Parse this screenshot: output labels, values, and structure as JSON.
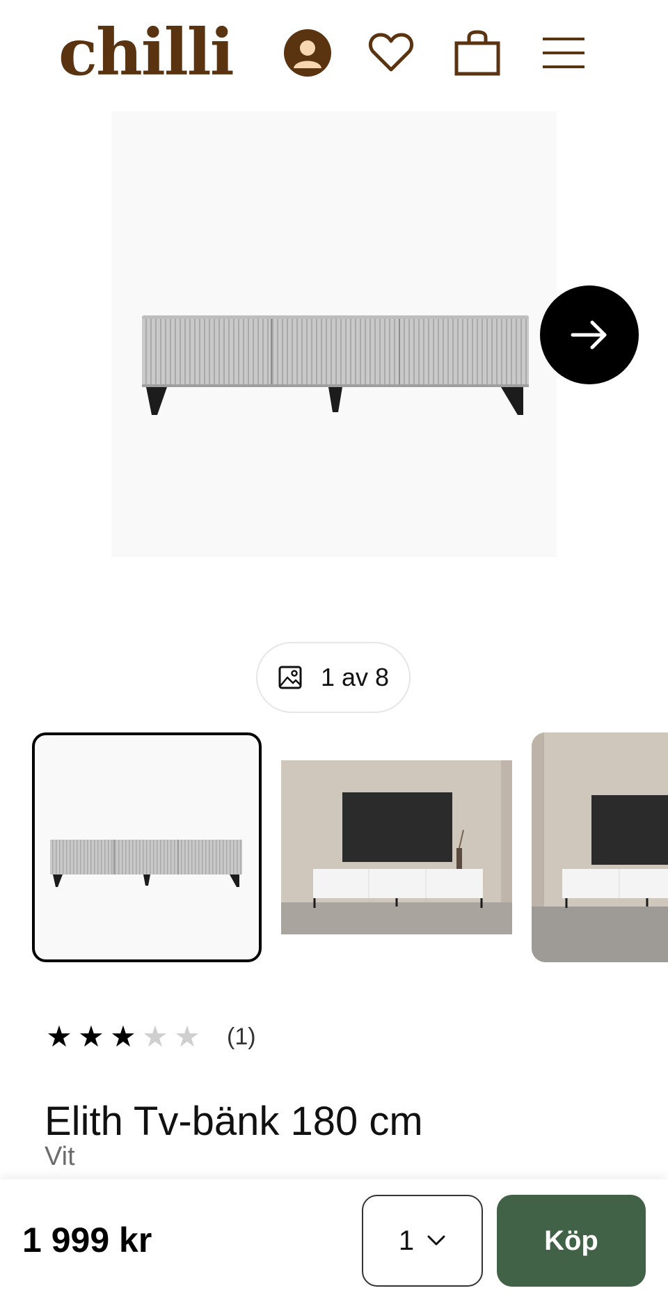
{
  "header": {
    "logo": "chilli",
    "icons": [
      "account-icon",
      "heart-icon",
      "bag-icon",
      "menu-icon"
    ]
  },
  "gallery": {
    "counter": "1 av 8",
    "current_index": 1,
    "total": 8
  },
  "product": {
    "rating": 3,
    "rating_max": 5,
    "review_count": "(1)",
    "title": "Elith Tv-bänk 180 cm",
    "variant": "Vit"
  },
  "purchase": {
    "price": "1 999 kr",
    "quantity": "1",
    "buy_label": "Köp"
  },
  "colors": {
    "brand": "#5a3310",
    "buy_button": "#426248",
    "star_active": "#000000",
    "star_inactive": "#cfcfcf"
  }
}
